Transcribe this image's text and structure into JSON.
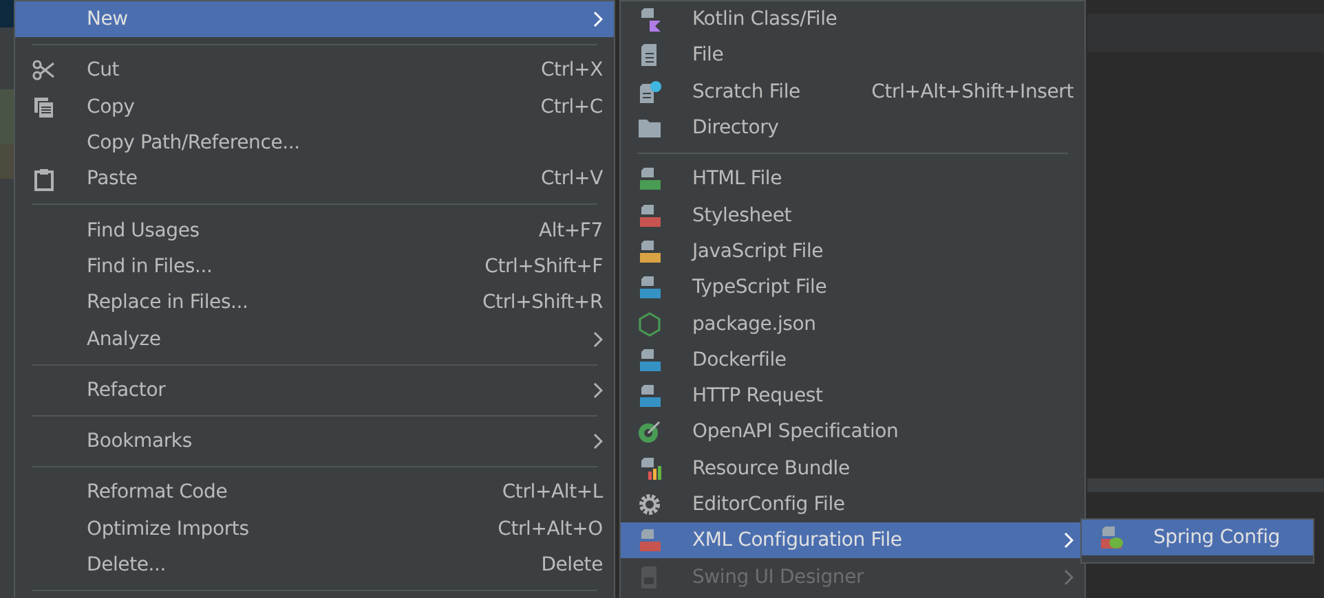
{
  "context_menu": {
    "items": [
      {
        "kind": "item",
        "label": "New",
        "has_submenu": true,
        "selected": true
      },
      {
        "kind": "separator"
      },
      {
        "kind": "item",
        "label": "Cut",
        "shortcut": "Ctrl+X",
        "has_submenu": false,
        "selected": false
      },
      {
        "kind": "item",
        "label": "Copy",
        "shortcut": "Ctrl+C",
        "has_submenu": false,
        "selected": false
      },
      {
        "kind": "item",
        "label": "Copy Path/Reference...",
        "has_submenu": false,
        "selected": false
      },
      {
        "kind": "item",
        "label": "Paste",
        "shortcut": "Ctrl+V",
        "has_submenu": false,
        "selected": false
      },
      {
        "kind": "separator"
      },
      {
        "kind": "item",
        "label": "Find Usages",
        "shortcut": "Alt+F7",
        "has_submenu": false,
        "selected": false
      },
      {
        "kind": "item",
        "label": "Find in Files...",
        "shortcut": "Ctrl+Shift+F",
        "has_submenu": false,
        "selected": false
      },
      {
        "kind": "item",
        "label": "Replace in Files...",
        "shortcut": "Ctrl+Shift+R",
        "has_submenu": false,
        "selected": false
      },
      {
        "kind": "item",
        "label": "Analyze",
        "has_submenu": true,
        "selected": false
      },
      {
        "kind": "separator"
      },
      {
        "kind": "item",
        "label": "Refactor",
        "has_submenu": true,
        "selected": false
      },
      {
        "kind": "separator"
      },
      {
        "kind": "item",
        "label": "Bookmarks",
        "has_submenu": true,
        "selected": false
      },
      {
        "kind": "separator"
      },
      {
        "kind": "item",
        "label": "Reformat Code",
        "shortcut": "Ctrl+Alt+L",
        "has_submenu": false,
        "selected": false
      },
      {
        "kind": "item",
        "label": "Optimize Imports",
        "shortcut": "Ctrl+Alt+O",
        "has_submenu": false,
        "selected": false
      },
      {
        "kind": "item",
        "label": "Delete...",
        "shortcut": "Delete",
        "has_submenu": false,
        "selected": false
      },
      {
        "kind": "separator"
      }
    ]
  },
  "new_submenu": {
    "items": [
      {
        "kind": "item",
        "label": "Kotlin Class/File",
        "has_submenu": false,
        "selected": false,
        "disabled": false
      },
      {
        "kind": "item",
        "label": "File",
        "has_submenu": false,
        "selected": false,
        "disabled": false
      },
      {
        "kind": "item",
        "label": "Scratch File",
        "shortcut": "Ctrl+Alt+Shift+Insert",
        "has_submenu": false,
        "selected": false,
        "disabled": false
      },
      {
        "kind": "item",
        "label": "Directory",
        "has_submenu": false,
        "selected": false,
        "disabled": false
      },
      {
        "kind": "separator"
      },
      {
        "kind": "item",
        "label": "HTML File",
        "has_submenu": false,
        "selected": false,
        "disabled": false
      },
      {
        "kind": "item",
        "label": "Stylesheet",
        "has_submenu": false,
        "selected": false,
        "disabled": false
      },
      {
        "kind": "item",
        "label": "JavaScript File",
        "has_submenu": false,
        "selected": false,
        "disabled": false
      },
      {
        "kind": "item",
        "label": "TypeScript File",
        "has_submenu": false,
        "selected": false,
        "disabled": false
      },
      {
        "kind": "item",
        "label": "package.json",
        "has_submenu": false,
        "selected": false,
        "disabled": false
      },
      {
        "kind": "item",
        "label": "Dockerfile",
        "has_submenu": false,
        "selected": false,
        "disabled": false
      },
      {
        "kind": "item",
        "label": "HTTP Request",
        "has_submenu": false,
        "selected": false,
        "disabled": false
      },
      {
        "kind": "item",
        "label": "OpenAPI Specification",
        "has_submenu": false,
        "selected": false,
        "disabled": false
      },
      {
        "kind": "item",
        "label": "Resource Bundle",
        "has_submenu": false,
        "selected": false,
        "disabled": false
      },
      {
        "kind": "item",
        "label": "EditorConfig File",
        "has_submenu": false,
        "selected": false,
        "disabled": false
      },
      {
        "kind": "item",
        "label": "XML Configuration File",
        "has_submenu": true,
        "selected": true,
        "disabled": false
      },
      {
        "kind": "item",
        "label": "Swing UI Designer",
        "has_submenu": true,
        "selected": false,
        "disabled": true
      }
    ]
  },
  "xml_submenu": {
    "items": [
      {
        "kind": "item",
        "label": "Spring Config",
        "has_submenu": false,
        "selected": true
      }
    ]
  }
}
